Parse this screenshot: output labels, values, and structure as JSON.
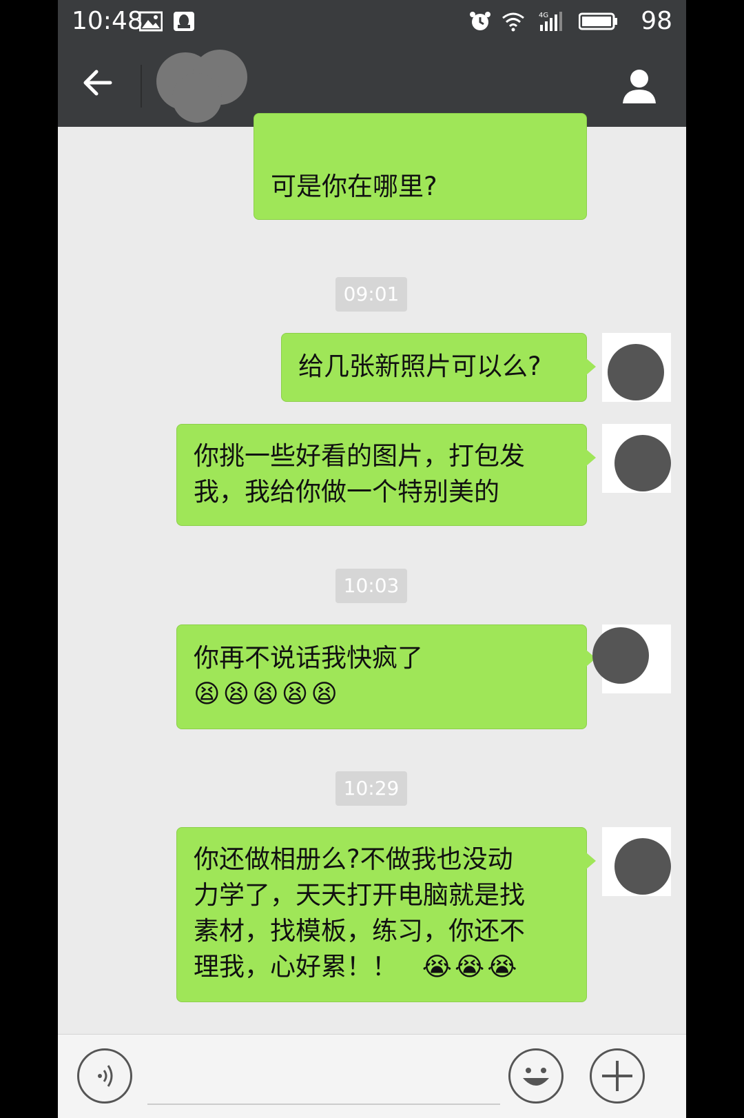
{
  "status_bar": {
    "time": "10:48",
    "battery": "98",
    "network": "4G"
  },
  "header": {
    "back_icon": "arrow-left-icon",
    "profile_icon": "person-icon"
  },
  "messages": [
    {
      "type": "sent",
      "text": "可是你在哪里?"
    },
    {
      "type": "time",
      "text": "09:01"
    },
    {
      "type": "sent",
      "text": "给几张新照片可以么?"
    },
    {
      "type": "sent",
      "lines": [
        "你挑一些好看的图片，打包发",
        "我，我给你做一个特别美的"
      ]
    },
    {
      "type": "time",
      "text": "10:03"
    },
    {
      "type": "sent",
      "text": "你再不说话我快疯了",
      "emoji": [
        "😫",
        "😫",
        "😫",
        "😫",
        "😫"
      ]
    },
    {
      "type": "time",
      "text": "10:29"
    },
    {
      "type": "sent",
      "lines": [
        "你还做相册么?不做我也没动",
        "力学了，天天打开电脑就是找",
        "素材，找模板，练习，你还不",
        "理我，心好累！！"
      ],
      "emoji": [
        "😭",
        "😭",
        "😭"
      ]
    }
  ],
  "input_bar": {
    "voice_icon": "voice-icon",
    "emoji_icon": "smiley-icon",
    "plus_icon": "plus-icon"
  },
  "colors": {
    "bubble": "#9fe658",
    "header": "#3a3c3e",
    "chat_bg": "#ebebeb"
  }
}
